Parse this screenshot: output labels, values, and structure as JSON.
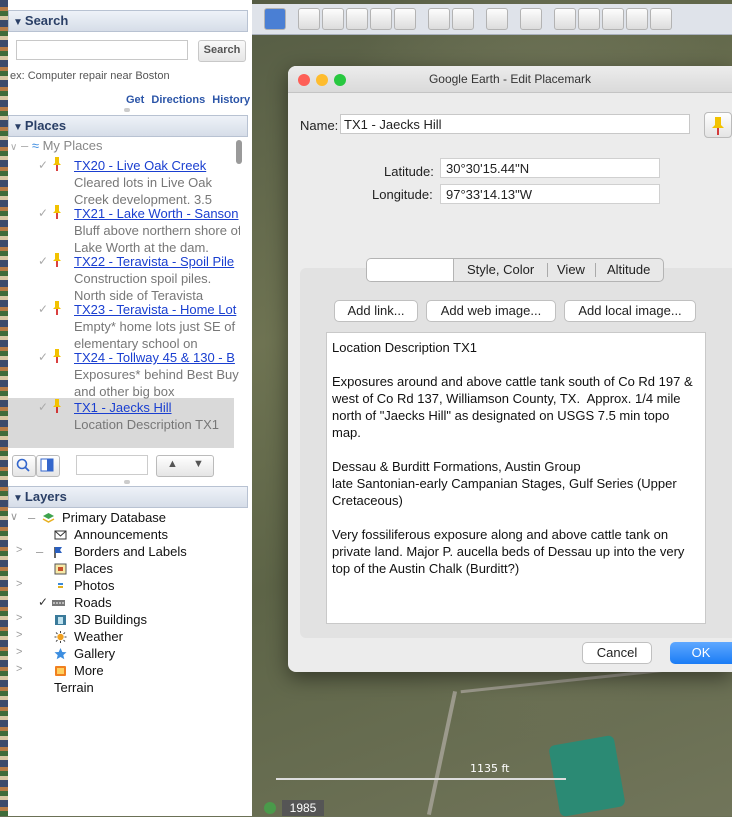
{
  "search": {
    "header": "Search",
    "placeholder": "",
    "button": "Search",
    "hint": "ex: Computer repair near Boston",
    "get_directions": "Get Directions",
    "history": "History"
  },
  "places": {
    "header": "Places",
    "root": "My Places",
    "items": [
      {
        "title": "TX20 - Live Oak Creek",
        "desc": "Cleared lots in Live Oak Creek development. 3.5"
      },
      {
        "title": "TX21 - Lake Worth - Sanson",
        "desc": "Bluff above northern shore of Lake Worth at the dam."
      },
      {
        "title": "TX22 - Teravista - Spoil Pile",
        "desc": "Construction spoil piles. North side of Teravista"
      },
      {
        "title": "TX23 - Teravista - Home Lot",
        "desc": "Empty* home lots just SE of elementary school on"
      },
      {
        "title": "TX24 - Tollway 45 & 130 - B",
        "desc": "Exposures* behind Best Buy and other big box"
      },
      {
        "title": "TX1 - Jaecks Hill",
        "desc": "Location Description TX1"
      }
    ]
  },
  "layers": {
    "header": "Layers",
    "items": [
      "Primary Database",
      "Announcements",
      "Borders and Labels",
      "Places",
      "Photos",
      "Roads",
      "3D Buildings",
      "Weather",
      "Gallery",
      "More",
      "Terrain"
    ]
  },
  "map": {
    "scale": "1135 ft",
    "year": "1985"
  },
  "dialog": {
    "title": "Google Earth - Edit Placemark",
    "name_label": "Name:",
    "name_value": "TX1 - Jaecks Hill",
    "latitude_label": "Latitude:",
    "latitude_value": "30°30'15.44\"N",
    "longitude_label": "Longitude:",
    "longitude_value": "97°33'14.13\"W",
    "tabs": [
      "",
      "Style, Color",
      "View",
      "Altitude"
    ],
    "add_link": "Add link...",
    "add_web_image": "Add web image...",
    "add_local_image": "Add local image...",
    "description": [
      "Location Description TX1",
      "Exposures around and above cattle tank south of Co Rd 197 & west of Co Rd 137, Williamson County, TX.  Approx. 1/4 mile north of \"Jaecks Hill\" as designated on USGS 7.5 min topo map.",
      "Dessau & Burditt Formations, Austin Group\nlate Santonian-early Campanian Stages, Gulf Series (Upper Cretaceous)",
      "Very fossiliferous exposure along and above cattle tank on private land. Major P. aucella beds of Dessau up into the very top of the Austin Chalk (Burditt?)"
    ],
    "cancel": "Cancel",
    "ok": "OK"
  },
  "colors": {
    "link": "#1a3fd0",
    "accent": "#1a7cf5",
    "header_text": "#2a3f66"
  }
}
